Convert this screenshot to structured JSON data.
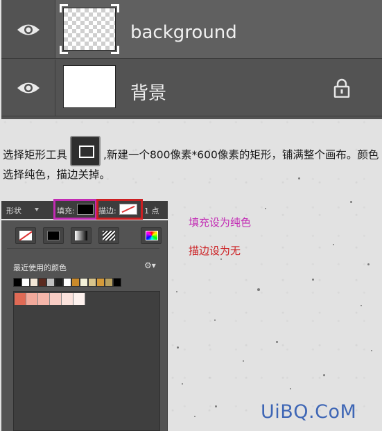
{
  "layers": [
    {
      "name": "background",
      "type": "transparent",
      "selected": true
    },
    {
      "name": "背景",
      "type": "white",
      "locked": true
    }
  ],
  "instruction": {
    "before_icon": "选择矩形工具",
    "after_icon": ",新建一个800像素*600像素的矩形，铺满整个画布。颜色选择纯色，描边关掉。"
  },
  "options_bar": {
    "shape_mode": "形状",
    "fill_label": "填充:",
    "stroke_label": "描边:",
    "stroke_width": "1 点"
  },
  "color_picker": {
    "recent_label": "最近使用的颜色",
    "recent_colors": [
      "#000000",
      "#ffffff",
      "#f2e6d6",
      "#5a2a1f",
      "#c0c0c0",
      "#1c1c1c",
      "#ffffff",
      "#c98a2b",
      "#f3f0d8",
      "#d8c48c",
      "#d49a3a",
      "#b8a060",
      "#000000"
    ],
    "preset_colors": [
      "#e06a55",
      "#f2a99b",
      "#f5b6aa",
      "#f8cdc4",
      "#fbe2dc",
      "#fdf1ed"
    ]
  },
  "notes": {
    "fill_note": "填充设为纯色",
    "stroke_note": "描边设为无"
  },
  "watermark": "UiBQ.CoM",
  "colors": {
    "fill_highlight": "#c22bb4",
    "stroke_highlight": "#cc1f22",
    "watermark": "#3e66b5"
  }
}
